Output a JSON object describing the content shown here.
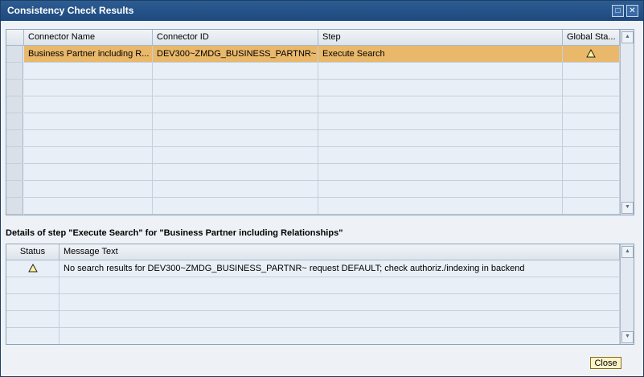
{
  "window": {
    "title": "Consistency Check Results",
    "maximize_icon": "□",
    "close_icon": "✕"
  },
  "results_table": {
    "columns": [
      "Connector Name",
      "Connector ID",
      "Step",
      "Global Sta..."
    ],
    "rows": [
      {
        "connector_name": "Business Partner including R...",
        "connector_id": "DEV300~ZMDG_BUSINESS_PARTNR~",
        "step": "Execute Search",
        "global_status": "warning-icon"
      }
    ]
  },
  "details": {
    "title": "Details of step \"Execute Search\" for \"Business Partner including Relationships\"",
    "columns": [
      "Status",
      "Message Text"
    ],
    "rows": [
      {
        "status": "warning-icon",
        "message": "No search results for DEV300~ZMDG_BUSINESS_PARTNR~ request DEFAULT; check authoriz./indexing in backend"
      }
    ]
  },
  "footer": {
    "close_label": "Close"
  },
  "colors": {
    "titlebar": "#1d4a7f",
    "selected_row": "#e9b86a",
    "grid_bg": "#e8eff6"
  }
}
